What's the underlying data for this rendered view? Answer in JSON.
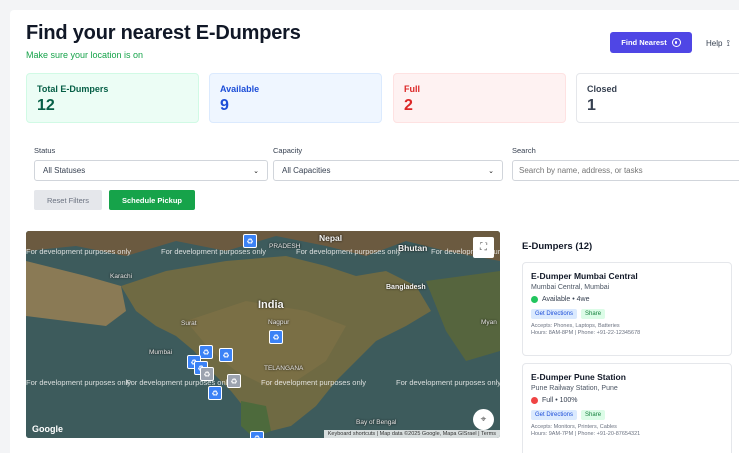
{
  "header": {
    "title": "Find your nearest E-Dumpers",
    "subtitle": "Make sure your location is on",
    "find_nearest_label": "Find Nearest",
    "help_label": "Help"
  },
  "stats": [
    {
      "label": "Total E-Dumpers",
      "value": "12"
    },
    {
      "label": "Available",
      "value": "9"
    },
    {
      "label": "Full",
      "value": "2"
    },
    {
      "label": "Closed",
      "value": "1"
    }
  ],
  "filters": {
    "status_label": "Status",
    "status_value": "All Statuses",
    "capacity_label": "Capacity",
    "capacity_value": "All Capacities",
    "search_label": "Search",
    "search_placeholder": "Search by name, address, or tasks",
    "reset_label": "Reset Filters",
    "pickup_label": "Schedule Pickup"
  },
  "map": {
    "dev_text": "For development purposes only",
    "labels": {
      "nepal": "Nepal",
      "bhutan": "Bhutan",
      "india": "India",
      "bangladesh": "Bangladesh",
      "karachi": "Karachi",
      "nagpur": "Nagpur",
      "surat": "Surat",
      "mumbai": "Mumbai",
      "telangana": "TELANGANA",
      "pradesh": "PRADESH",
      "myanmar": "Myan",
      "bay": "Bay of Bengal"
    },
    "google": "Google",
    "attribution": "Keyboard shortcuts  |  Map data ©2025 Google, Mapa GISrael  |  Terms"
  },
  "list": {
    "title": "E-Dumpers (12)",
    "items": [
      {
        "name": "E-Dumper Mumbai Central",
        "address": "Mumbai Central, Mumbai",
        "status": "Available • 4we",
        "status_color": "#22c55e",
        "directions": "Get Directions",
        "share": "Share",
        "accepts": "Accepts: Phones, Laptops, Batteries",
        "hours": "Hours: 8AM-8PM | Phone: +91-22-12345678"
      },
      {
        "name": "E-Dumper Pune Station",
        "address": "Pune Railway Station, Pune",
        "status": "Full • 100%",
        "status_color": "#ef4444",
        "directions": "Get Directions",
        "share": "Share",
        "accepts": "Accepts: Monitors, Printers, Cables",
        "hours": "Hours: 9AM-7PM | Phone: +91-20-87654321"
      }
    ]
  },
  "colors": {
    "primary": "#4f46e5",
    "success": "#16a34a",
    "danger": "#dc2626"
  }
}
